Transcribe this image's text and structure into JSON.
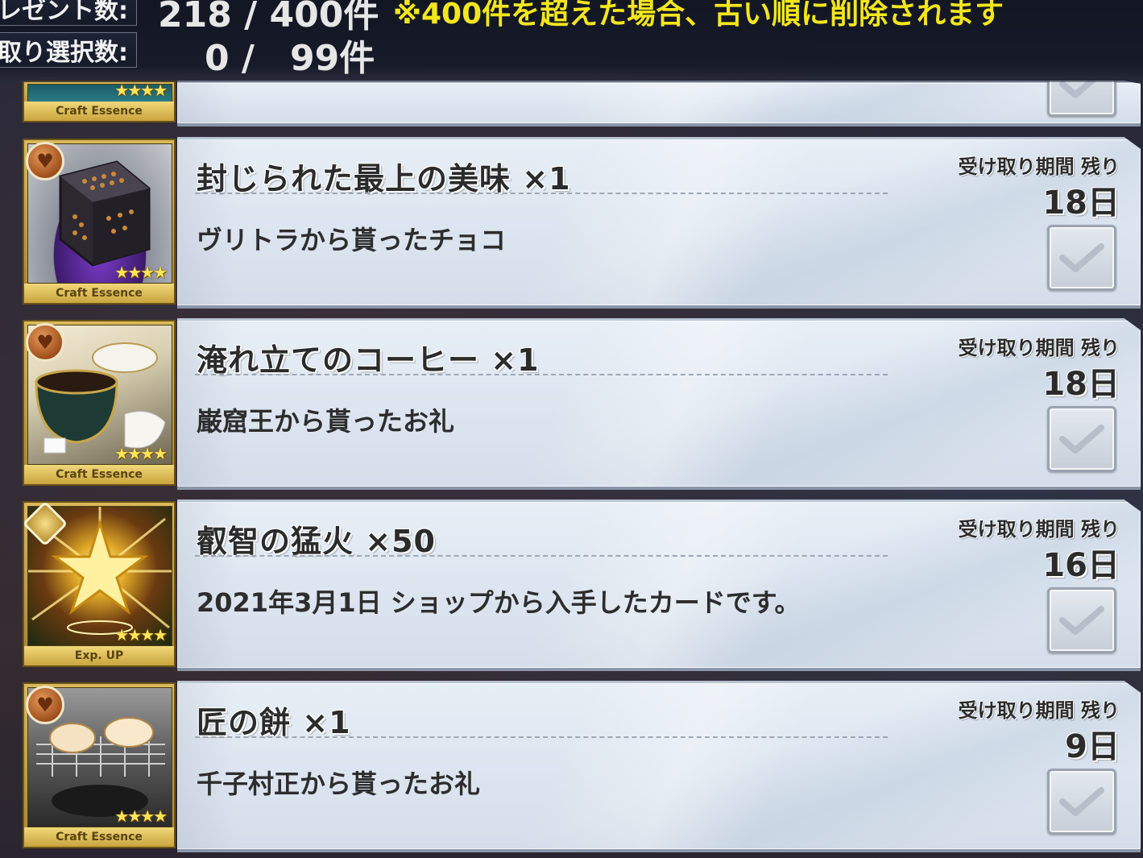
{
  "header": {
    "present_count_label": "レゼント数:",
    "present_count_value": "218 / 400件",
    "present_warning": "※400件を超えた場合、古い順に削除されます",
    "selected_label": "け取り選択数:",
    "selected_value": "0 /　99件"
  },
  "partial_item": {
    "card_label": "Craft Essence",
    "stars": "★★★★"
  },
  "items": [
    {
      "name": "封じられた最上の美味 ×1",
      "description": "ヴリトラから貰ったチョコ",
      "period_label": "受け取り期間 残り",
      "period_value": "18日",
      "card_label": "Craft Essence",
      "stars": "★★★★",
      "art_icon": "cube-icon"
    },
    {
      "name": "淹れ立てのコーヒー ×1",
      "description": "巌窟王から貰ったお礼",
      "period_label": "受け取り期間 残り",
      "period_value": "18日",
      "card_label": "Craft Essence",
      "stars": "★★★★",
      "art_icon": "coffee-icon"
    },
    {
      "name": "叡智の猛火 ×50",
      "description": "2021年3月1日 ショップから入手したカードです。",
      "period_label": "受け取り期間 残り",
      "period_value": "16日",
      "card_label": "Exp. UP",
      "stars": "★★★★",
      "art_icon": "star-burst-icon"
    },
    {
      "name": "匠の餅 ×1",
      "description": "千子村正から貰ったお礼",
      "period_label": "受け取り期間 残り",
      "period_value": "9日",
      "card_label": "Craft Essence",
      "stars": "★★★★",
      "art_icon": "mochi-icon"
    }
  ],
  "colors": {
    "warning_text": "#f3e61c",
    "panel_bg": "#e3eaf3",
    "card_gold": "#d9b95a"
  }
}
